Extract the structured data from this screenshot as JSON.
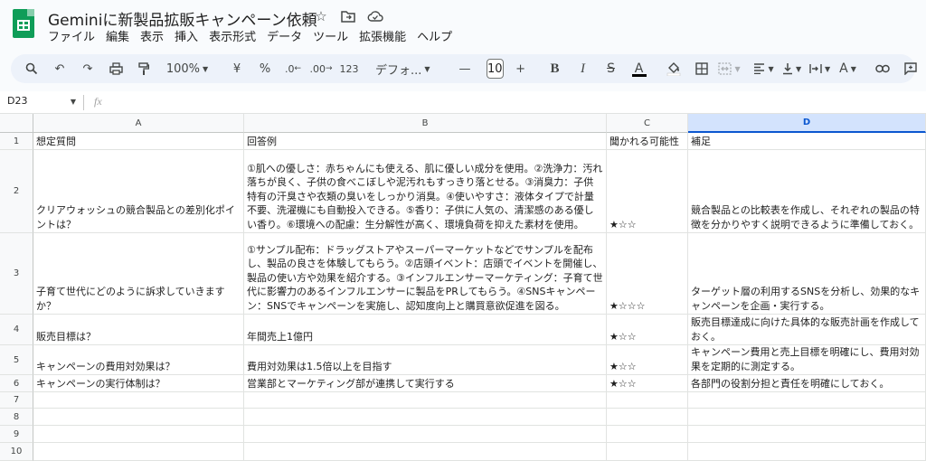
{
  "app": {
    "title": "Geminiに新製品拡販キャンペーン依頼",
    "menu": [
      "ファイル",
      "編集",
      "表示",
      "挿入",
      "表示形式",
      "データ",
      "ツール",
      "拡張機能",
      "ヘルプ"
    ]
  },
  "toolbar": {
    "zoom": "100%",
    "currency": "¥",
    "percent": "%",
    "dec_decrease": ".0",
    "dec_increase": ".00",
    "number_format": "123",
    "font": "デフォ...",
    "font_size": "10",
    "bold": "B",
    "italic": "I",
    "strike": "S",
    "text_color": "A",
    "text_rotate": "A"
  },
  "formula_bar": {
    "name_box": "D23",
    "fx": "fx",
    "value": ""
  },
  "columns": [
    "A",
    "B",
    "C",
    "D"
  ],
  "selected_column": "D",
  "rows": [
    {
      "num": "1",
      "a": "想定質問",
      "b": "回答例",
      "c": "聞かれる可能性",
      "d": "補足"
    },
    {
      "num": "2",
      "a": "クリアウォッシュの競合製品との差別化ポイントは？",
      "b": "①肌への優しさ：赤ちゃんにも使える、肌に優しい成分を使用。②洗浄力：汚れ落ちが良く、子供の食べこぼしや泥汚れもすっきり落とせる。③消臭力：子供特有の汗臭さや衣類の臭いをしっかり消臭。④使いやすさ：液体タイプで計量不要、洗濯機にも自動投入できる。⑤香り：子供に人気の、清潔感のある優しい香り。⑥環境への配慮：生分解性が高く、環境負荷を抑えた素材を使用。",
      "c": "★☆☆",
      "d": "競合製品との比較表を作成し、それぞれの製品の特徴を分かりやすく説明できるように準備しておく。"
    },
    {
      "num": "3",
      "a": "子育て世代にどのように訴求していきますか？",
      "b": "①サンプル配布：ドラッグストアやスーパーマーケットなどでサンプルを配布し、製品の良さを体験してもらう。②店頭イベント：店頭でイベントを開催し、製品の使い方や効果を紹介する。③インフルエンサーマーケティング：子育て世代に影響力のあるインフルエンサーに製品をPRしてもらう。④SNSキャンペーン：SNSでキャンペーンを実施し、認知度向上と購買意欲促進を図る。",
      "c": "★☆☆☆",
      "d": "ターゲット層の利用するSNSを分析し、効果的なキャンペーンを企画・実行する。"
    },
    {
      "num": "4",
      "a": "販売目標は？",
      "b": "年間売上1億円",
      "c": "★☆☆",
      "d": "販売目標達成に向けた具体的な販売計画を作成しておく。"
    },
    {
      "num": "5",
      "a": "キャンペーンの費用対効果は？",
      "b": "費用対効果は1.5倍以上を目指す",
      "c": "★☆☆",
      "d": "キャンペーン費用と売上目標を明確にし、費用対効果を定期的に測定する。"
    },
    {
      "num": "6",
      "a": "キャンペーンの実行体制は？",
      "b": "営業部とマーケティング部が連携して実行する",
      "c": "★☆☆",
      "d": "各部門の役割分担と責任を明確にしておく。"
    },
    {
      "num": "7",
      "a": "",
      "b": "",
      "c": "",
      "d": ""
    },
    {
      "num": "8",
      "a": "",
      "b": "",
      "c": "",
      "d": ""
    },
    {
      "num": "9",
      "a": "",
      "b": "",
      "c": "",
      "d": ""
    },
    {
      "num": "10",
      "a": "",
      "b": "",
      "c": "",
      "d": ""
    }
  ]
}
